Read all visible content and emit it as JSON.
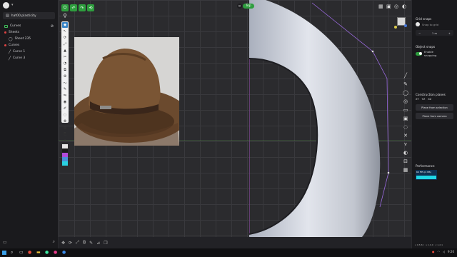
{
  "sidebar": {
    "file_name": "hat00.plasticity",
    "tree": [
      {
        "label": "Curves",
        "kind": "head"
      },
      {
        "label": "Sheets",
        "kind": "section"
      },
      {
        "label": "Sheet 235",
        "kind": "sub"
      },
      {
        "label": "Curves",
        "kind": "section"
      },
      {
        "label": "Curve 1",
        "kind": "sub"
      },
      {
        "label": "Curve 3",
        "kind": "sub"
      }
    ]
  },
  "viewport": {
    "view_label": "Top",
    "left_tools": [
      "select",
      "move",
      "rotate",
      "scale",
      "extrude",
      "cut",
      "fillet",
      "offset",
      "bool",
      "curve",
      "edit",
      "mirror",
      "camera",
      "sketch",
      "hide",
      "lock",
      "trash",
      "clip",
      "export"
    ],
    "swatches": [
      "#e6e6e6",
      "#1a1a1a",
      "#b14bd9",
      "#4a90d9",
      "#2ad1e0"
    ],
    "right_tools": [
      "line",
      "pen",
      "circle",
      "circle-2",
      "rect",
      "rect-2",
      "spiral",
      "cross",
      "branch",
      "half-circle",
      "split",
      "grid"
    ]
  },
  "right_panel": {
    "grid_snaps_title": "Grid snaps",
    "snap_to_grid": "Snap to grid",
    "grid_value": "1 m",
    "object_snaps_title": "Object snaps",
    "enable_snapping": "Enable snapping",
    "construction_planes_title": "Construction planes",
    "planes": [
      "XY",
      "YZ",
      "XZ"
    ],
    "plane_from_selection": "Plane from selection",
    "plane_from_camera": "Plane from camera",
    "performance_title": "Performance",
    "perf_label": "60 FPS (4 MS)",
    "footer": [
      "v 0.5.52",
      "v 1.0.0",
      "v 1.2.1"
    ]
  },
  "taskbar": {
    "time": "9:20",
    "date": "2024"
  }
}
